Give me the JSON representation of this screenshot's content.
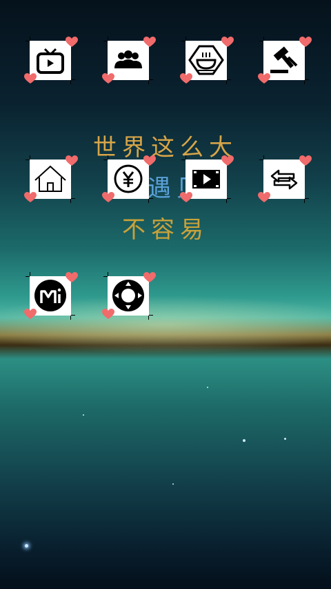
{
  "wallpaper": {
    "slogan_line1": "世界这么大",
    "slogan_line2": "遇见",
    "slogan_line3": "不容易",
    "line1_color": "#d8a548",
    "line2_color": "#5aa0d8",
    "line3_color": "#c9a23a"
  },
  "home_icons": [
    {
      "name": "tv-icon"
    },
    {
      "name": "group-icon"
    },
    {
      "name": "coffee-icon"
    },
    {
      "name": "gavel-icon"
    },
    {
      "name": "home-icon"
    },
    {
      "name": "yen-coin-icon"
    },
    {
      "name": "video-player-icon"
    },
    {
      "name": "transfer-arrows-icon"
    },
    {
      "name": "mi-icon"
    },
    {
      "name": "gamepad-icon"
    }
  ],
  "decor": {
    "heart_color": "#f06b6b"
  }
}
